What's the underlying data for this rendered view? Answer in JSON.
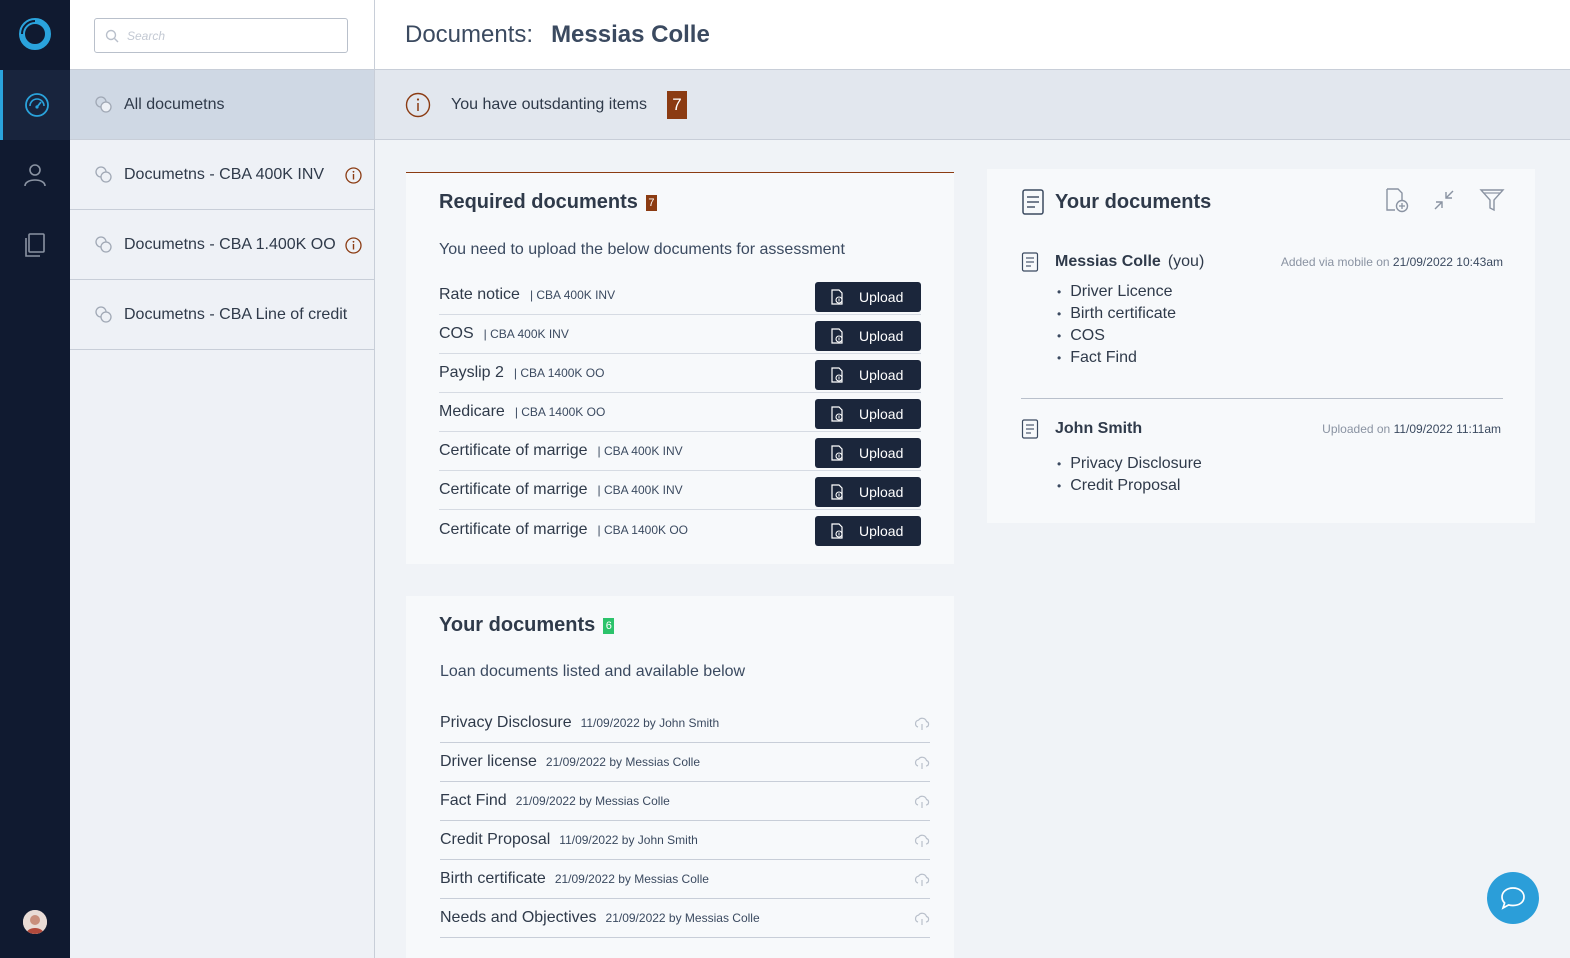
{
  "search": {
    "placeholder": "Search"
  },
  "sidebar": {
    "items": [
      {
        "label": "All documetns"
      },
      {
        "label": "Documetns - CBA 400K INV"
      },
      {
        "label": "Documetns - CBA 1.400K OO"
      },
      {
        "label": "Documetns - CBA Line of credit"
      }
    ]
  },
  "header": {
    "prefix": "Documents:",
    "name": "Messias Colle"
  },
  "alert": {
    "text": "You have outsdanting items",
    "count": "7"
  },
  "required": {
    "title": "Required documents",
    "badge": "7",
    "subtitle": "You need to upload the below documents for assessment",
    "upload_label": "Upload",
    "rows": [
      {
        "name": "Rate notice",
        "tag": "| CBA 400K INV"
      },
      {
        "name": "COS",
        "tag": "| CBA 400K INV"
      },
      {
        "name": "Payslip 2",
        "tag": "| CBA 1400K OO"
      },
      {
        "name": "Medicare",
        "tag": "| CBA 1400K OO"
      },
      {
        "name": "Certificate of marrige",
        "tag": "| CBA 400K INV"
      },
      {
        "name": "Certificate of marrige",
        "tag": "| CBA 400K INV"
      },
      {
        "name": "Certificate of marrige",
        "tag": "| CBA 1400K OO"
      }
    ]
  },
  "your_docs": {
    "title": "Your documents",
    "badge": "6",
    "subtitle": "Loan documents listed and available below",
    "rows": [
      {
        "name": "Privacy Disclosure",
        "meta": "11/09/2022 by John Smith"
      },
      {
        "name": "Driver license",
        "meta": "21/09/2022 by Messias Colle"
      },
      {
        "name": "Fact Find",
        "meta": "21/09/2022 by Messias Colle"
      },
      {
        "name": "Credit Proposal",
        "meta": "11/09/2022 by John Smith"
      },
      {
        "name": "Birth certificate",
        "meta": "21/09/2022 by Messias Colle"
      },
      {
        "name": "Needs and Objectives",
        "meta": "21/09/2022 by Messias Colle"
      }
    ]
  },
  "right_panel": {
    "title": "Your documents",
    "groups": [
      {
        "who": "Messias Colle",
        "you": "(you)",
        "meta_prefix": "Added via mobile on",
        "meta_date": "21/09/2022 10:43am",
        "items": [
          "Driver Licence",
          "Birth certificate",
          "COS",
          "Fact Find"
        ]
      },
      {
        "who": "John Smith",
        "meta_prefix": "Uploaded on",
        "meta_date": "11/09/2022 11:11am",
        "items": [
          "Privacy Disclosure",
          "Credit Proposal"
        ]
      }
    ]
  },
  "colors": {
    "rail": "#101a30",
    "accent": "#2aa3dc",
    "warning": "#8b3b12",
    "success": "#2cc36b",
    "button": "#1b263b"
  },
  "icons": {
    "rail": [
      "logo-icon",
      "dashboard-icon",
      "user-icon",
      "documents-icon"
    ],
    "right_tools": [
      "add-document-icon",
      "collapse-icon",
      "filter-icon"
    ]
  }
}
